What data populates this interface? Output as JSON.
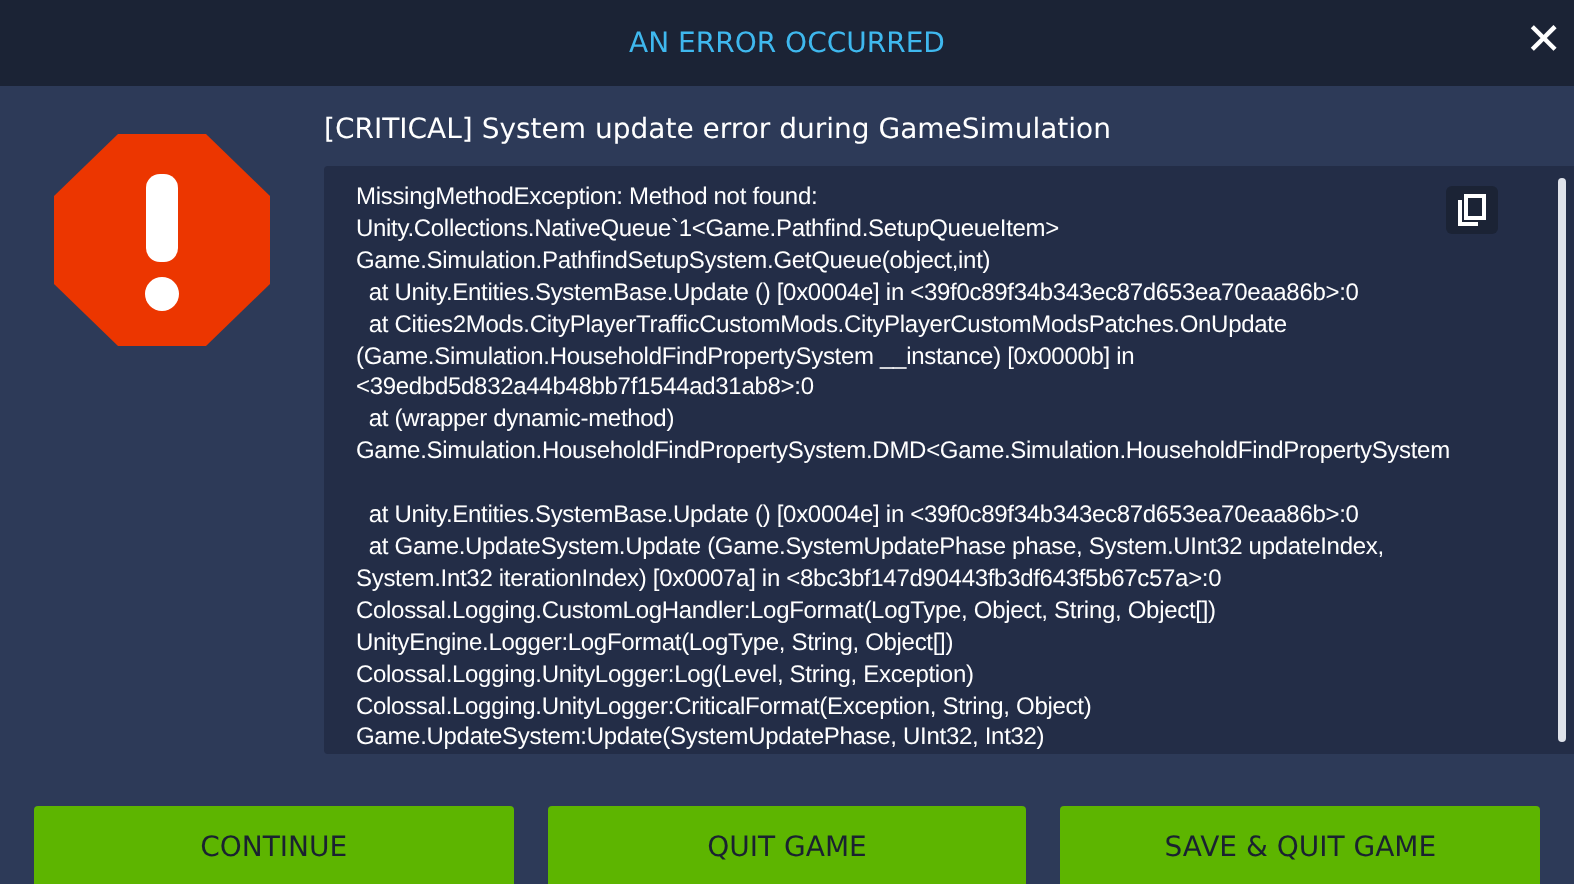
{
  "window": {
    "title": "AN ERROR OCCURRED",
    "close": "✕"
  },
  "message": {
    "heading": "[CRITICAL] System update error during GameSimulation",
    "log": "MissingMethodException: Method not found:\nUnity.Collections.NativeQueue`1<Game.Pathfind.SetupQueueItem>\nGame.Simulation.PathfindSetupSystem.GetQueue(object,int)\n  at Unity.Entities.SystemBase.Update () [0x0004e] in <39f0c89f34b343ec87d653ea70eaa86b>:0\n  at Cities2Mods.CityPlayerTrafficCustomMods.CityPlayerCustomModsPatches.OnUpdate\n(Game.Simulation.HouseholdFindPropertySystem __instance) [0x0000b] in\n<39edbd5d832a44b48bb7f1544ad31ab8>:0\n  at (wrapper dynamic-method)\nGame.Simulation.HouseholdFindPropertySystem.DMD<Game.Simulation.HouseholdFindPropertySystem\n\n  at Unity.Entities.SystemBase.Update () [0x0004e] in <39f0c89f34b343ec87d653ea70eaa86b>:0\n  at Game.UpdateSystem.Update (Game.SystemUpdatePhase phase, System.UInt32 updateIndex,\nSystem.Int32 iterationIndex) [0x0007a] in <8bc3bf147d90443fb3df643f5b67c57a>:0\nColossal.Logging.CustomLogHandler:LogFormat(LogType, Object, String, Object[])\nUnityEngine.Logger:LogFormat(LogType, String, Object[])\nColossal.Logging.UnityLogger:Log(Level, String, Exception)\nColossal.Logging.UnityLogger:CriticalFormat(Exception, String, Object)\nGame.UpdateSystem:Update(SystemUpdatePhase, UInt32, Int32)"
  },
  "buttons": [
    {
      "label": "CONTINUE"
    },
    {
      "label": "QUIT GAME"
    },
    {
      "label": "SAVE & QUIT GAME"
    }
  ]
}
